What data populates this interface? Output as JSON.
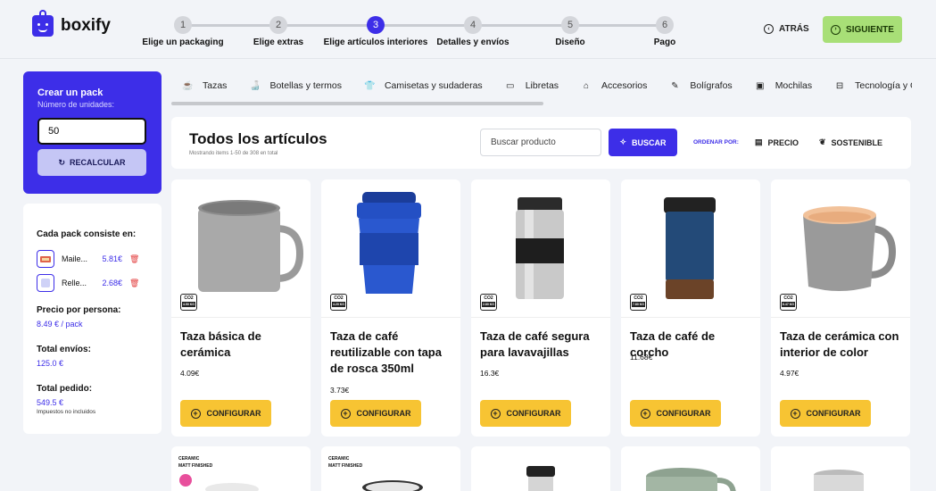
{
  "brand": {
    "name": "boxify",
    "color": "#3d2ee8"
  },
  "steps": [
    {
      "num": "1",
      "label": "Elige un packaging"
    },
    {
      "num": "2",
      "label": "Elige extras"
    },
    {
      "num": "3",
      "label": "Elige artículos interiores",
      "active": true
    },
    {
      "num": "4",
      "label": "Detalles y envíos"
    },
    {
      "num": "5",
      "label": "Diseño"
    },
    {
      "num": "6",
      "label": "Pago"
    }
  ],
  "nav": {
    "back_label": "ATRÁS",
    "next_label": "SIGUIENTE"
  },
  "pack": {
    "title": "Crear un pack",
    "units_label": "Número de unidades:",
    "units_value": "50",
    "recalc_label": "RECALCULAR"
  },
  "summary": {
    "heading": "Cada pack consiste en:",
    "items": [
      {
        "name": "Maile...",
        "price": "5.81€"
      },
      {
        "name": "Relle...",
        "price": "2.68€"
      }
    ],
    "per_person_label": "Precio por persona:",
    "per_person_value": "8.49 € / pack",
    "shipping_label": "Total envíos:",
    "shipping_value": "125.0 €",
    "total_label": "Total pedido:",
    "total_value": "549.5 €",
    "tax_note": "Impuestos no incluidos"
  },
  "categories": [
    {
      "label": "Tazas",
      "icon": "mug-icon"
    },
    {
      "label": "Botellas y termos",
      "icon": "bottle-icon"
    },
    {
      "label": "Camisetas y sudaderas",
      "icon": "shirt-icon"
    },
    {
      "label": "Libretas",
      "icon": "notebook-icon"
    },
    {
      "label": "Accesorios",
      "icon": "hat-icon"
    },
    {
      "label": "Bolígrafos",
      "icon": "pen-icon"
    },
    {
      "label": "Mochilas",
      "icon": "backpack-icon"
    },
    {
      "label": "Tecnología y Gadgets",
      "icon": "tech-icon"
    }
  ],
  "listing": {
    "title": "Todos los artículos",
    "subtitle": "Mostrando items 1-50 de 308 en total",
    "search_placeholder": "Buscar producto",
    "search_button": "BUSCAR",
    "sort_label": "ORDENAR POR:",
    "sort_price": "PRECIO",
    "sort_sustainable": "SOSTENIBLE"
  },
  "products": [
    {
      "name": "Taza básica de cerámica",
      "price": "4.09€",
      "co2_kg": "4.50 KG",
      "image": "grey-ceramic-mug"
    },
    {
      "name": "Taza de café reutilizable con tapa de rosca 350ml",
      "price": "3.73€",
      "co2_kg": "4.20 KG",
      "image": "blue-reusable-cup"
    },
    {
      "name": "Taza de café segura para lavavajillas",
      "price": "16.3€",
      "co2_kg": "2.80 KG",
      "image": "steel-travel-mug"
    },
    {
      "name": "Taza de café de corcho",
      "price": "11.68€",
      "co2_kg": "7.80 KG",
      "image": "blue-cork-mug"
    },
    {
      "name": "Taza de cerámica con interior de color",
      "price": "4.97€",
      "co2_kg": "6.47 KG",
      "image": "grey-mug-peach-inside"
    }
  ],
  "product_labels": {
    "configure": "CONFIGURAR",
    "co2": "CO2"
  },
  "row2_tags": [
    {
      "l1": "CERAMIC",
      "l2": "MATT FINISHED"
    },
    {
      "l1": "CERAMIC",
      "l2": "MATT FINISHED"
    }
  ],
  "colors": {
    "accent": "#3d2ee8",
    "success": "#a8df77",
    "configure": "#f7c433",
    "delete": "#e23b3b"
  }
}
